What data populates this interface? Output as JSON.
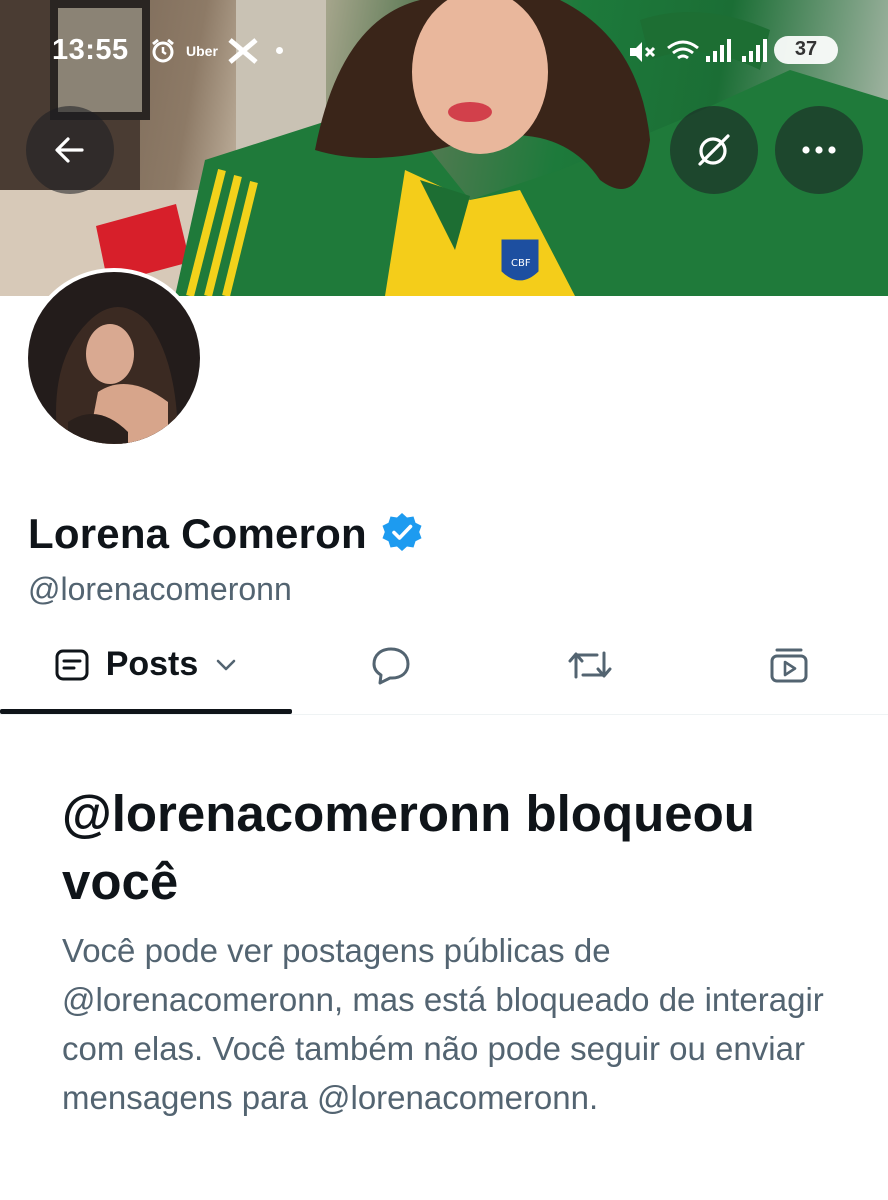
{
  "status_bar": {
    "time": "13:55",
    "notification_app": "Uber",
    "battery": "37"
  },
  "header": {
    "back_icon": "arrow-left-icon",
    "grok_icon": "grok-icon",
    "more_icon": "more-horizontal-icon"
  },
  "profile": {
    "display_name": "Lorena Comeron",
    "handle": "@lorenacomeronn",
    "verified": true,
    "verified_color": "#1d9bf0"
  },
  "tabs": [
    {
      "label": "Posts",
      "icon": "posts-icon",
      "active": true,
      "has_dropdown": true
    },
    {
      "label": "",
      "icon": "replies-icon",
      "active": false
    },
    {
      "label": "",
      "icon": "repost-icon",
      "active": false
    },
    {
      "label": "",
      "icon": "media-icon",
      "active": false
    }
  ],
  "blocked_notice": {
    "title": "@lorenacomeronn bloqueou você",
    "message": "Você pode ver postagens públicas de @lorenacomeronn, mas está bloqueado de interagir com elas. Você também não pode seguir ou enviar mensagens para @lorenacomeronn."
  },
  "colors": {
    "text_primary": "#0f1419",
    "text_secondary": "#536471",
    "verified": "#1d9bf0"
  }
}
